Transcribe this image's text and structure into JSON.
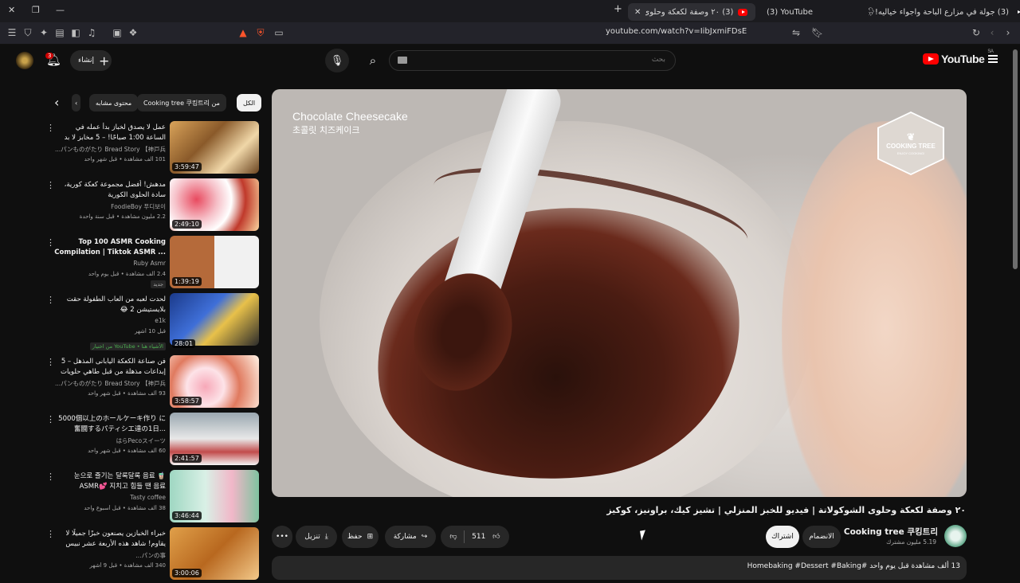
{
  "browser": {
    "tabs": [
      {
        "label": "(3) جولة في مزارع الباحة واجواء خياليه!🌧",
        "active": false
      },
      {
        "label": "(3) YouTube",
        "active": false
      },
      {
        "label": "(3) ٢٠ وصفة لكعكة وحلوى الشو...",
        "active": true
      }
    ],
    "new_tab": "+",
    "close": "✕",
    "url": "youtube.com/watch?v=IibJxmiFDsE"
  },
  "header": {
    "search_placeholder": "بحث",
    "create_label": "إنشاء",
    "notification_count": "3",
    "logo_text": "YouTube",
    "region": "SA"
  },
  "chips": [
    {
      "label": "الكل",
      "selected": true
    },
    {
      "label": "من Cooking tree 쿠킹트리",
      "selected": false
    },
    {
      "label": "محتوى مشابه",
      "selected": false
    }
  ],
  "related": [
    {
      "title": "عمل لا يصدق لخباز بدأ عمله في الساعة 1:00 صباحًا! – 5 مخابز لا بد من زيارتها ...",
      "channel": "パンものがたり Bread Story 【神戸兵...",
      "meta": "101 ألف مشاهدة • قبل شهر واحد",
      "duration": "3:59:47",
      "extra": ""
    },
    {
      "title": "مدهش! أفضل مجموعة كعكة كورية، سادة الحلوى الكورية",
      "channel": "FoodieBoy 푸디보이",
      "meta": "2.2 مليون مشاهدة • قبل سنة واحدة",
      "duration": "2:49:10",
      "extra": ""
    },
    {
      "title": "Top 100 ASMR Cooking Compilation | Tiktok ASMR ...",
      "channel": "Ruby Asmr",
      "meta": "2.4 ألف مشاهدة • قبل يوم واحد",
      "duration": "1:39:19",
      "extra": "جديد"
    },
    {
      "title": "لحدت لعبه من العاب الطفولة حقت بلايستيشن 2 😂",
      "channel": "e1k",
      "meta": "قبل 10 أشهر",
      "duration": "28:01",
      "extra": "من اختيار YouTube • الأشياء هنا"
    },
    {
      "title": "فن صناعة الكعكة اليابانى المذهل – 5 إبداعات مذهلة من قبل طاهي حلويات",
      "channel": "パンものがたり Bread Story 【神戸兵...",
      "meta": "93 ألف مشاهدة • قبل شهر واحد",
      "duration": "3:58:57",
      "extra": ""
    },
    {
      "title": "5000個以上のホールケーキ作り に奮闘するパティシエ達の1日...",
      "channel": "はらPecoスイーツ",
      "meta": "60 ألف مشاهدة • قبل شهر واحد",
      "duration": "2:41:57",
      "extra": ""
    },
    {
      "title": "🧋 눈으로 즐기는 달록달록 음료 ASMR💕 지치고 힘들 땐 음료",
      "channel": "Tasty coffee",
      "meta": "38 ألف مشاهدة • قبل أسبوع واحد",
      "duration": "3:46:44",
      "extra": ""
    },
    {
      "title": "خبراء الخبازين يصنعون خبزًا جميلًا لا يقاوم! شاهد هذه الأربعة عشر نبيس بالجنة!",
      "channel": "パンの事…",
      "meta": "340 ألف مشاهدة • قبل 9 أشهر",
      "duration": "3:00:06",
      "extra": ""
    }
  ],
  "player": {
    "overlay_title": "Chocolate Cheesecake",
    "overlay_subtitle": "초콜릿 치즈케이크",
    "logo_text": "COOKING TREE",
    "logo_sub": "ENJOY COOKING!"
  },
  "video": {
    "title": "٢٠ وصفة لكعكة وحلوى الشوكولاتة | فيديو للخبز المنزلي | تشيز كيك، براونيز، كوكيز",
    "channel_name": "Cooking tree 쿠킹트리",
    "subscribers": "5.19 مليون مشترك",
    "join_label": "الانضمام",
    "subscribe_label": "اشتراك",
    "like_count": "511",
    "share_label": "مشاركة",
    "save_label": "حفظ",
    "download_label": "تنزيل",
    "description": "13 ألف مشاهدة قبل يوم واحد  #Homebaking #Dessert #Baking"
  },
  "colors": {
    "accent": "#ff0000",
    "background": "#0f0f0f",
    "chip": "#272727"
  }
}
